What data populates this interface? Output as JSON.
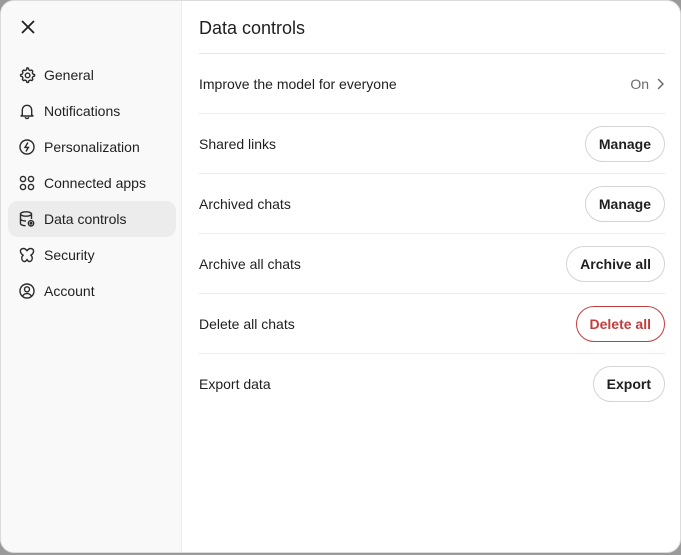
{
  "dialog": {
    "title": "Data controls"
  },
  "sidebar": {
    "items": [
      {
        "label": "General",
        "icon": "gear-icon"
      },
      {
        "label": "Notifications",
        "icon": "bell-icon"
      },
      {
        "label": "Personalization",
        "icon": "personalization-icon"
      },
      {
        "label": "Connected apps",
        "icon": "apps-icon"
      },
      {
        "label": "Data controls",
        "icon": "database-icon",
        "active": true
      },
      {
        "label": "Security",
        "icon": "security-icon"
      },
      {
        "label": "Account",
        "icon": "account-icon"
      }
    ]
  },
  "settings": {
    "improve_model": {
      "label": "Improve the model for everyone",
      "value": "On"
    },
    "shared_links": {
      "label": "Shared links",
      "button": "Manage"
    },
    "archived_chats": {
      "label": "Archived chats",
      "button": "Manage"
    },
    "archive_all": {
      "label": "Archive all chats",
      "button": "Archive all"
    },
    "delete_all": {
      "label": "Delete all chats",
      "button": "Delete all"
    },
    "export_data": {
      "label": "Export data",
      "button": "Export"
    }
  },
  "colors": {
    "danger": "#c43d3d",
    "active_nav_bg": "#ececec",
    "sidebar_bg": "#f9f9f9"
  }
}
